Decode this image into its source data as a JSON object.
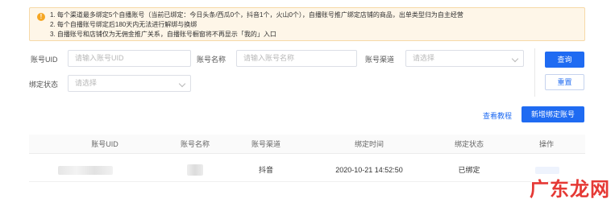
{
  "notice": {
    "icon": "warning-icon",
    "lines": [
      "1. 每个渠道最多绑定5个自播账号（当前已绑定：今日头条/西瓜0个，抖音1个，火山0个），自播账号推广绑定店铺的商品，出单类型归为自主经营",
      "2. 每个自播账号绑定后180天内无法进行解绑与换绑",
      "3. 自播账号和店铺仅为无佣金推广关系，自播账号橱窗将不再显示「我的」入口"
    ]
  },
  "filters": {
    "uid_label": "账号UID",
    "uid_placeholder": "请输入账号UID",
    "name_label": "账号名称",
    "name_placeholder": "请输入账号名称",
    "channel_label": "账号渠道",
    "channel_placeholder": "请选择",
    "status_label": "绑定状态",
    "status_placeholder": "请选择"
  },
  "buttons": {
    "query": "查询",
    "reset": "重置",
    "tutorial": "查看教程",
    "add": "新增绑定账号"
  },
  "table": {
    "columns": [
      "账号UID",
      "账号名称",
      "账号渠道",
      "绑定时间",
      "绑定状态",
      "操作"
    ],
    "rows": [
      {
        "channel": "抖音",
        "time": "2020-10-21 14:52:50",
        "status": "已绑定"
      }
    ]
  },
  "watermark": "广东龙网",
  "colors": {
    "primary": "#1f6bf2",
    "warning": "#f5a623",
    "notice_bg": "#fef6e8"
  }
}
